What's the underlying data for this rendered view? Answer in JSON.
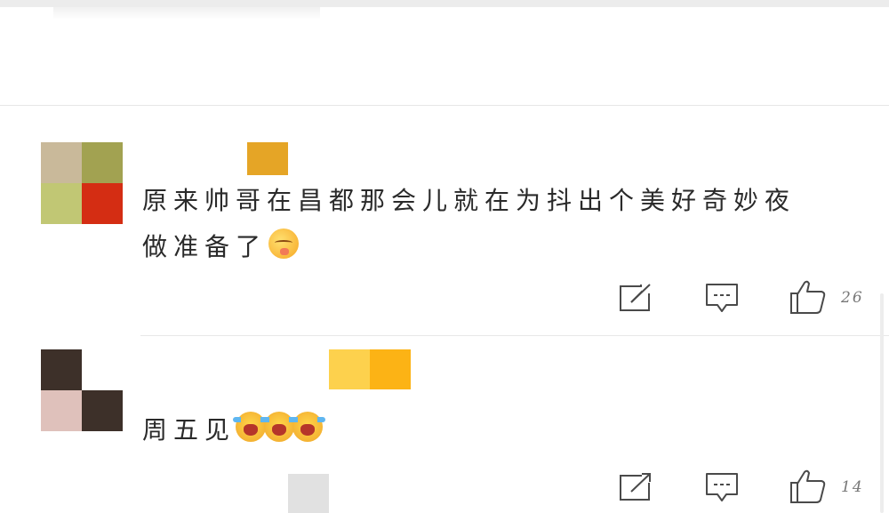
{
  "comments": [
    {
      "avatar_colors": [
        "#c9b99a",
        "#a2a251",
        "#c1c774",
        "#d42d13"
      ],
      "name_colors": [
        "#e5a526"
      ],
      "text_line1": "原来帅哥在昌都那会儿就在为抖出个美好奇妙夜",
      "text_line2": "做准备了",
      "emoji": "shy-face-emoji",
      "like_count": "26"
    },
    {
      "avatar_colors": [
        "#3d3029",
        "#ffffff",
        "#dfc1bb",
        "#3d3029"
      ],
      "name_colors": [
        "#fdd14d",
        "#fcb315"
      ],
      "text_line1": "周五见",
      "emoji": "crying-laughing-emoji",
      "like_count": "14"
    }
  ],
  "icons": {
    "share": "share-icon",
    "reply": "reply-icon",
    "like": "thumbs-up-icon"
  }
}
